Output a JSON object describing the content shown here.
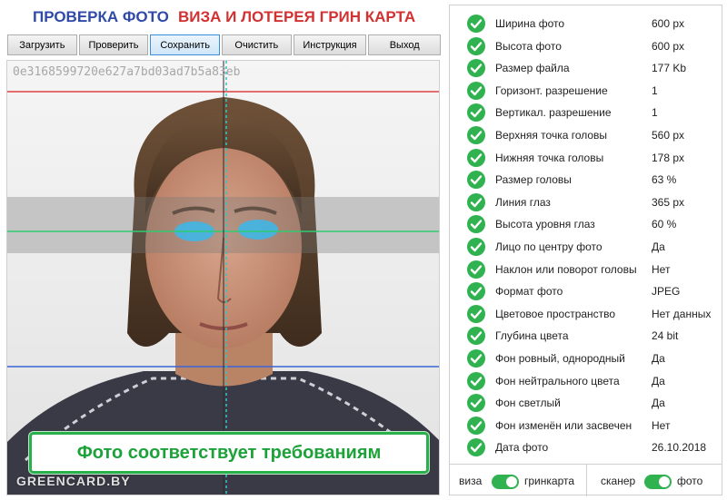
{
  "header": {
    "title_left": "ПРОВЕРКА ФОТО",
    "title_right": "ВИЗА И ЛОТЕРЕЯ ГРИН КАРТА"
  },
  "toolbar": {
    "buttons": [
      "Загрузить",
      "Проверить",
      "Сохранить",
      "Очистить",
      "Инструкция",
      "Выход"
    ],
    "active": "Сохранить"
  },
  "photo": {
    "hash": "0e3168599720e627a7bd03ad7b5a83eb",
    "result": "Фото соответствует требованиям",
    "watermark": "GREENCARD.BY"
  },
  "checks": [
    {
      "label": "Ширина фото",
      "value": "600 px"
    },
    {
      "label": "Высота фото",
      "value": "600 px"
    },
    {
      "label": "Размер файла",
      "value": "177 Kb"
    },
    {
      "label": "Горизонт. разрешение",
      "value": "1"
    },
    {
      "label": "Вертикал. разрешение",
      "value": "1"
    },
    {
      "label": "Верхняя точка головы",
      "value": "560 px"
    },
    {
      "label": "Нижняя точка головы",
      "value": "178 px"
    },
    {
      "label": "Размер головы",
      "value": "63 %"
    },
    {
      "label": "Линия глаз",
      "value": "365 px"
    },
    {
      "label": "Высота уровня глаз",
      "value": "60 %"
    },
    {
      "label": "Лицо по центру фото",
      "value": "Да"
    },
    {
      "label": "Наклон или поворот головы",
      "value": "Нет"
    },
    {
      "label": "Формат фото",
      "value": "JPEG"
    },
    {
      "label": "Цветовое пространство",
      "value": "Нет данных"
    },
    {
      "label": "Глубина цвета",
      "value": "24 bit"
    },
    {
      "label": "Фон ровный, однородный",
      "value": "Да"
    },
    {
      "label": "Фон нейтрального цвета",
      "value": "Да"
    },
    {
      "label": "Фон светлый",
      "value": "Да"
    },
    {
      "label": "Фон изменён или засвечен",
      "value": "Нет"
    },
    {
      "label": "Дата фото",
      "value": "26.10.2018"
    }
  ],
  "toggles": {
    "left_a": "виза",
    "left_b": "гринкарта",
    "right_a": "сканер",
    "right_b": "фото"
  },
  "colors": {
    "title_blue": "#2f4aa8",
    "title_red": "#d23131",
    "accent_green": "#2fb24f",
    "guide_red": "#e04040",
    "guide_green": "#2ecc71",
    "guide_blue": "#3a64d8",
    "eye_marker": "#3fb6e6"
  },
  "icons": {
    "check": "check-circle-icon"
  }
}
